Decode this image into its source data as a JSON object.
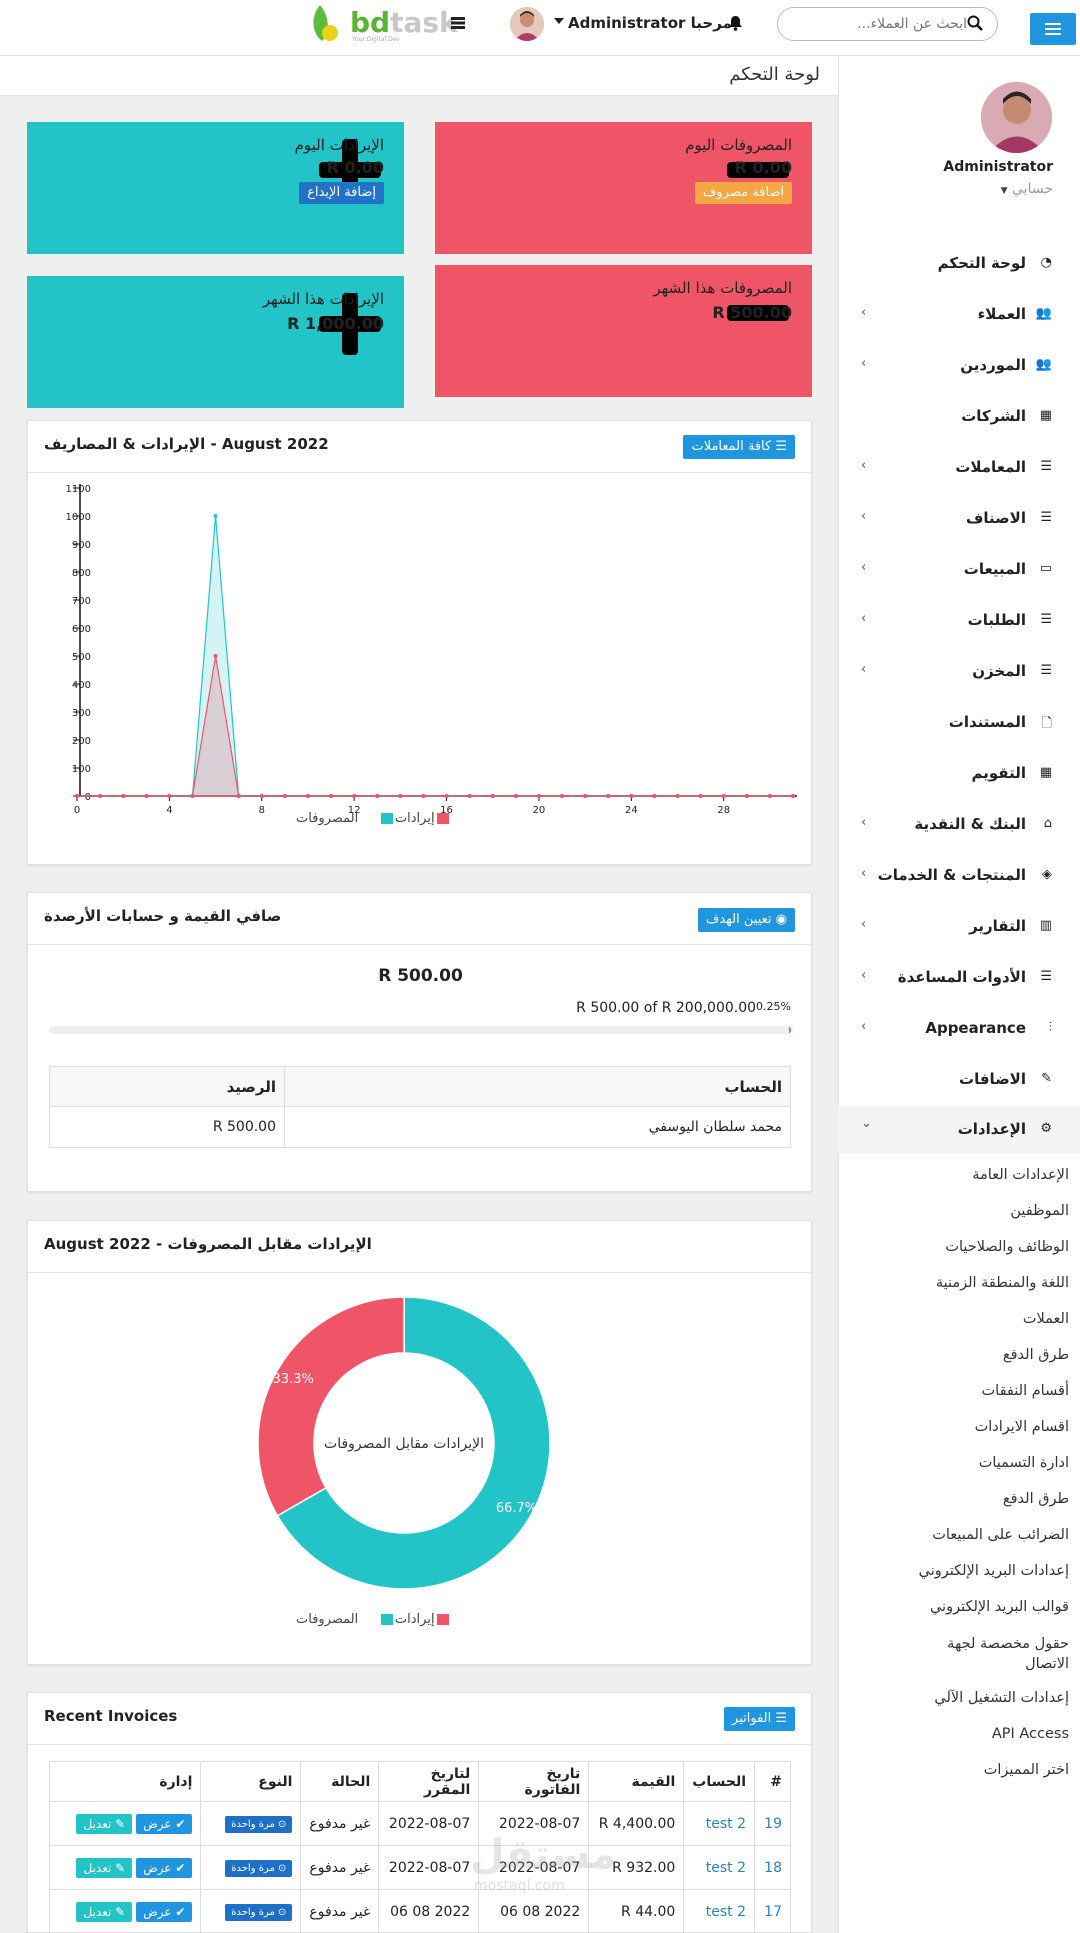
{
  "header": {
    "search_placeholder": "ابحث عن العملاء...",
    "greeting": "مرحبا Administrator",
    "logo_main": "bd",
    "logo_second": "task",
    "logo_tagline": "Your Digital Dev"
  },
  "sidebar": {
    "user_name": "Administrator",
    "account_label": "حسابي",
    "items": [
      {
        "label": "لوحة التحكم",
        "icon": "dashboard-icon",
        "chevron": false
      },
      {
        "label": "العملاء",
        "icon": "users-icon",
        "chevron": true
      },
      {
        "label": "الموردين",
        "icon": "users-icon",
        "chevron": true
      },
      {
        "label": "الشركات",
        "icon": "building-icon",
        "chevron": false
      },
      {
        "label": "المعاملات",
        "icon": "database-icon",
        "chevron": true
      },
      {
        "label": "الاصناف",
        "icon": "database-icon",
        "chevron": true
      },
      {
        "label": "المبيعات",
        "icon": "card-icon",
        "chevron": true
      },
      {
        "label": "الطلبات",
        "icon": "list-icon",
        "chevron": true
      },
      {
        "label": "المخزن",
        "icon": "list-icon",
        "chevron": true
      },
      {
        "label": "المستندات",
        "icon": "file-icon",
        "chevron": false
      },
      {
        "label": "التقويم",
        "icon": "calendar-icon",
        "chevron": false
      },
      {
        "label": "البنك & النقدية",
        "icon": "bank-icon",
        "chevron": true
      },
      {
        "label": "المنتجات & الخدمات",
        "icon": "cube-icon",
        "chevron": true
      },
      {
        "label": "التقارير",
        "icon": "bar-chart-icon",
        "chevron": true
      },
      {
        "label": "الأدوات المساعدة",
        "icon": "tasks-icon",
        "chevron": true
      },
      {
        "label": "Appearance",
        "icon": "sliders-icon",
        "chevron": true
      },
      {
        "label": "الاضافات",
        "icon": "plug-icon",
        "chevron": false
      },
      {
        "label": "الإعدادات",
        "icon": "cogs-icon",
        "chevron": true,
        "open": true
      }
    ],
    "settings_sub": [
      "الإعدادات العامة",
      "الموظفين",
      "الوظائف والصلاحيات",
      "اللغة والمنطقة الزمنية",
      "العملات",
      "طرق الدفع",
      "أقسام النفقات",
      "اقسام الايرادات",
      "ادارة التسميات",
      "طرق الدفع",
      "الضرائب على المبيعات",
      "إعدادات البريد الإلكتروني",
      "قوالب البريد الإلكتروني",
      "حقول مخصصة لجهة الاتصال",
      "إعدادات التشغيل الآلي",
      "API Access",
      "اختر المميزات"
    ]
  },
  "page_title": "لوحة التحكم",
  "cards": {
    "expenses_today": {
      "title": "المصروفات اليوم",
      "value": "R 0.00",
      "button": "اضافة مصروف"
    },
    "income_today": {
      "title": "الإيرادات اليوم",
      "value": "R 0.00",
      "button": "إضافة الإيداع"
    },
    "expenses_month": {
      "title": "المصروفات هذا الشهر",
      "value": "R 500.00"
    },
    "income_month": {
      "title": "الإيرادات هذا الشهر",
      "value": "R 1,000.00"
    }
  },
  "income_expense_panel": {
    "title": "الإيرادات & المصاريف - August 2022",
    "button": "كافة المعاملات",
    "legend_expenses": "المصروفات",
    "legend_income": "إيرادات"
  },
  "net_worth_panel": {
    "title": "صافي القيمة و حسابات الأرصدة",
    "button": "تعيين الهدف",
    "amount": "R 500.00",
    "goal_text": "R 500.00 of R 200,000.00",
    "percent": "0.25%",
    "progress": 0.0025,
    "col_account": "الحساب",
    "col_balance": "الرصيد",
    "rows": [
      {
        "account": "محمد سلطان اليوسفي",
        "balance": "R 500.00"
      }
    ]
  },
  "donut_panel": {
    "title": "الإيرادات مقابل المصروفات - August 2022",
    "center_text": "الإيرادات مقابل المصروفات",
    "legend_expenses": "المصروفات",
    "legend_income": "إيرادات"
  },
  "invoices_panel": {
    "title": "Recent Invoices",
    "button": "الفواتير",
    "headers": [
      "#",
      "الحساب",
      "القيمة",
      "تاريخ الفاتورة",
      "لتاريخ المقرر",
      "الحالة",
      "النوع",
      "إدارة"
    ],
    "rows": [
      {
        "id": "19",
        "account": "test 2",
        "amount": "R 4,400.00",
        "invoice_date": "2022-08-07",
        "due_date": "2022-08-07",
        "status": "غير مدفوع",
        "type": "مرة واحدة",
        "view": "عرض",
        "edit": "تعديل"
      },
      {
        "id": "18",
        "account": "test 2",
        "amount": "R 932.00",
        "invoice_date": "2022-08-07",
        "due_date": "2022-08-07",
        "status": "غير مدفوع",
        "type": "مرة واحدة",
        "view": "عرض",
        "edit": "تعديل"
      },
      {
        "id": "17",
        "account": "test 2",
        "amount": "R 44.00",
        "invoice_date": "2022 08 06",
        "due_date": "2022 08 06",
        "status": "غير مدفوع",
        "type": "مرة واحدة",
        "view": "عرض",
        "edit": "تعديل"
      }
    ]
  },
  "watermark": {
    "main": "مستقل",
    "sub": "mostaql.com"
  },
  "colors": {
    "primary": "#2196e0",
    "teal": "#22c4c7",
    "red": "#ef5566",
    "orange": "#f5a742"
  },
  "chart_data": [
    {
      "type": "area",
      "title": "الإيرادات & المصاريف - August 2022",
      "x": [
        0,
        1,
        2,
        3,
        4,
        5,
        6,
        7,
        8,
        9,
        10,
        11,
        12,
        13,
        14,
        15,
        16,
        17,
        18,
        19,
        20,
        21,
        22,
        23,
        24,
        25,
        26,
        27,
        28,
        29,
        30,
        31
      ],
      "xticks": [
        0,
        4,
        8,
        12,
        16,
        20,
        24,
        28
      ],
      "yticks": [
        0,
        100,
        200,
        300,
        400,
        500,
        600,
        700,
        800,
        900,
        1000,
        1100
      ],
      "ylim": [
        0,
        1100
      ],
      "series": [
        {
          "name": "إيرادات",
          "color": "#22c4c7",
          "values": [
            0,
            0,
            0,
            0,
            0,
            0,
            1000,
            0,
            0,
            0,
            0,
            0,
            0,
            0,
            0,
            0,
            0,
            0,
            0,
            0,
            0,
            0,
            0,
            0,
            0,
            0,
            0,
            0,
            0,
            0,
            0,
            0
          ]
        },
        {
          "name": "المصروفات",
          "color": "#ef5566",
          "values": [
            0,
            0,
            0,
            0,
            0,
            0,
            500,
            0,
            0,
            0,
            0,
            0,
            0,
            0,
            0,
            0,
            0,
            0,
            0,
            0,
            0,
            0,
            0,
            0,
            0,
            0,
            0,
            0,
            0,
            0,
            0,
            0
          ]
        }
      ],
      "legend": "bottom",
      "grid": false
    },
    {
      "type": "pie",
      "title": "الإيرادات مقابل المصروفات - August 2022",
      "labels": [
        "إيرادات",
        "المصروفات"
      ],
      "values": [
        66.7,
        33.3
      ],
      "value_labels": [
        "66.7%",
        "33.3%"
      ],
      "colors": [
        "#22c4c7",
        "#ef5566"
      ],
      "donut": true,
      "legend": "bottom"
    }
  ]
}
